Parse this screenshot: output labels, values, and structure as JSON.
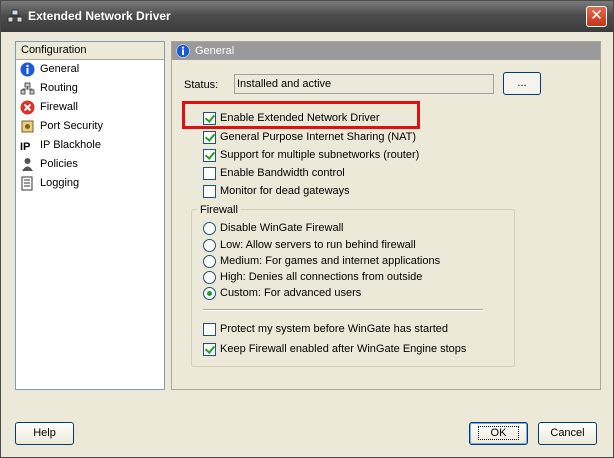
{
  "window": {
    "title": "Extended Network Driver",
    "close_label": "✕"
  },
  "nav": {
    "header": "Configuration",
    "items": [
      {
        "label": "General",
        "icon": "info-icon"
      },
      {
        "label": "Routing",
        "icon": "routing-icon"
      },
      {
        "label": "Firewall",
        "icon": "firewall-icon"
      },
      {
        "label": "Port Security",
        "icon": "port-security-icon"
      },
      {
        "label": "IP Blackhole",
        "icon": "ip-icon"
      },
      {
        "label": "Policies",
        "icon": "policies-icon"
      },
      {
        "label": "Logging",
        "icon": "logging-icon"
      }
    ]
  },
  "content": {
    "header": "General",
    "status_label": "Status:",
    "status_value": "Installed and active",
    "browse_label": "...",
    "options": [
      {
        "label": "Enable Extended Network Driver",
        "checked": true
      },
      {
        "label": "General Purpose Internet Sharing (NAT)",
        "checked": true
      },
      {
        "label": "Support for multiple subnetworks (router)",
        "checked": true
      },
      {
        "label": "Enable Bandwidth control",
        "checked": false
      },
      {
        "label": "Monitor for dead gateways",
        "checked": false
      }
    ],
    "firewall": {
      "title": "Firewall",
      "levels": [
        {
          "label": "Disable WinGate Firewall",
          "checked": false
        },
        {
          "label": "Low: Allow servers to run behind firewall",
          "checked": false
        },
        {
          "label": "Medium: For games and internet applications",
          "checked": false
        },
        {
          "label": "High: Denies all connections from outside",
          "checked": false
        },
        {
          "label": "Custom: For advanced users",
          "checked": true
        }
      ],
      "extras": [
        {
          "label": "Protect my system before WinGate has started",
          "checked": false
        },
        {
          "label": "Keep Firewall enabled after WinGate Engine stops",
          "checked": true
        }
      ]
    }
  },
  "buttons": {
    "help": "Help",
    "ok": "OK",
    "cancel": "Cancel"
  },
  "colors": {
    "highlight": "#e01010",
    "check": "#21a121",
    "header_bg": "#9a9a9a"
  }
}
